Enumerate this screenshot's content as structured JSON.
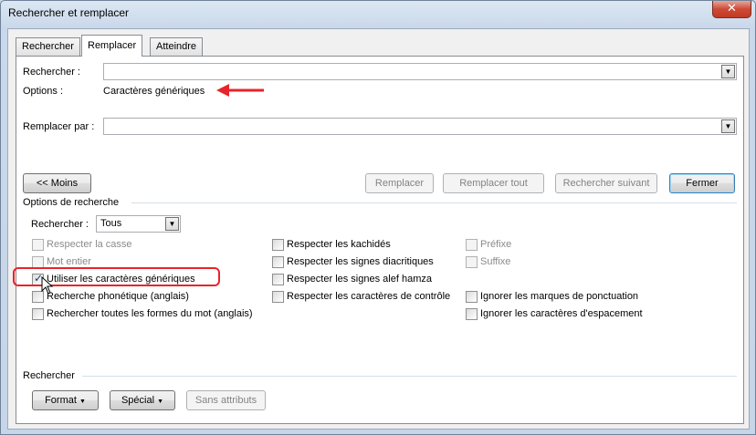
{
  "window": {
    "title": "Rechercher et remplacer",
    "close_glyph": "✕"
  },
  "tabs": [
    {
      "label": "Rechercher",
      "active": false
    },
    {
      "label": "Remplacer",
      "active": true
    },
    {
      "label": "Atteindre",
      "active": false
    }
  ],
  "find": {
    "label": "Rechercher :",
    "value": ""
  },
  "options": {
    "label": "Options :",
    "value": "Caractères génériques"
  },
  "replace": {
    "label": "Remplacer par :",
    "value": ""
  },
  "buttons": {
    "less": "<< Moins",
    "replace": "Remplacer",
    "replace_all": "Remplacer tout",
    "find_next": "Rechercher suivant",
    "close": "Fermer"
  },
  "search_options": {
    "section_label": "Options de recherche",
    "direction_label": "Rechercher :",
    "direction_value": "Tous"
  },
  "checkboxes_left": [
    {
      "label": "Respecter la casse",
      "checked": false,
      "disabled": true
    },
    {
      "label": "Mot entier",
      "checked": false,
      "disabled": true
    },
    {
      "label": "Utiliser les caractères génériques",
      "checked": true,
      "disabled": false
    },
    {
      "label": "Recherche phonétique (anglais)",
      "checked": false,
      "disabled": false
    },
    {
      "label": "Rechercher toutes les formes du mot (anglais)",
      "checked": false,
      "disabled": false
    }
  ],
  "checkboxes_middle": [
    {
      "label": "Respecter les kachidés",
      "checked": false,
      "disabled": false
    },
    {
      "label": "Respecter les signes diacritiques",
      "checked": false,
      "disabled": false
    },
    {
      "label": "Respecter les signes alef hamza",
      "checked": false,
      "disabled": false
    },
    {
      "label": "Respecter les caractères de contrôle",
      "checked": false,
      "disabled": false
    }
  ],
  "checkboxes_right": [
    {
      "label": "Préfixe",
      "checked": false,
      "disabled": true
    },
    {
      "label": "Suffixe",
      "checked": false,
      "disabled": true
    },
    {
      "label": "Ignorer les marques de ponctuation",
      "checked": false,
      "disabled": false
    },
    {
      "label": "Ignorer les caractères d'espacement",
      "checked": false,
      "disabled": false
    }
  ],
  "bottom": {
    "section_label": "Rechercher",
    "format": "Format",
    "special": "Spécial",
    "no_format": "Sans attributs"
  },
  "colors": {
    "annotation_red": "#e8242a"
  },
  "icons": {
    "dropdown": "chevron-down-icon",
    "check": "check-icon",
    "cursor": "mouse-pointer-icon"
  }
}
